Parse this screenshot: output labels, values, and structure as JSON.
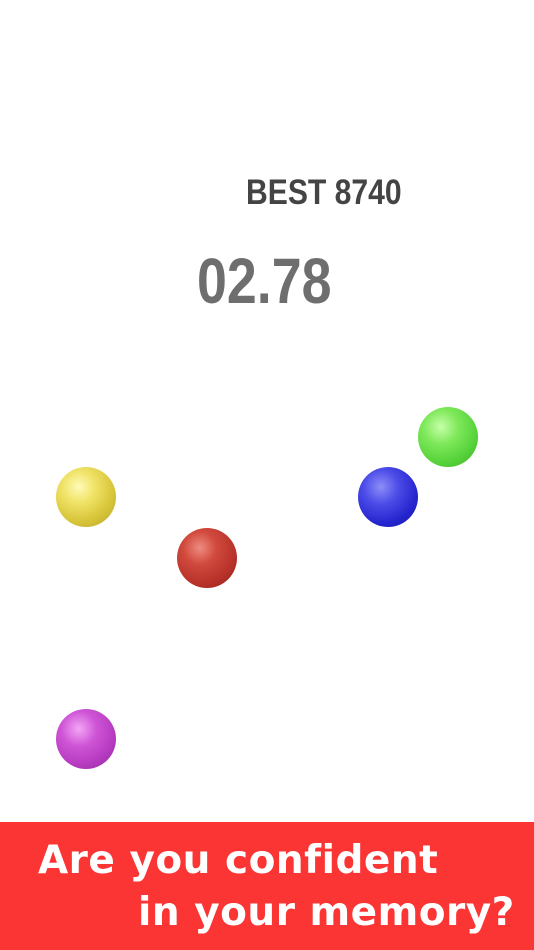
{
  "hud": {
    "best_label": "BEST 8740",
    "timer": "02.78"
  },
  "balls": [
    {
      "color_name": "yellow",
      "color": "#e6d550"
    },
    {
      "color_name": "red",
      "color": "#c43a30"
    },
    {
      "color_name": "blue",
      "color": "#2a2ad8"
    },
    {
      "color_name": "green",
      "color": "#62d844"
    },
    {
      "color_name": "purple",
      "color": "#c048cc"
    }
  ],
  "banner": {
    "line1": "Are you confident",
    "line2": "in your memory?",
    "background": "#fb3434"
  }
}
